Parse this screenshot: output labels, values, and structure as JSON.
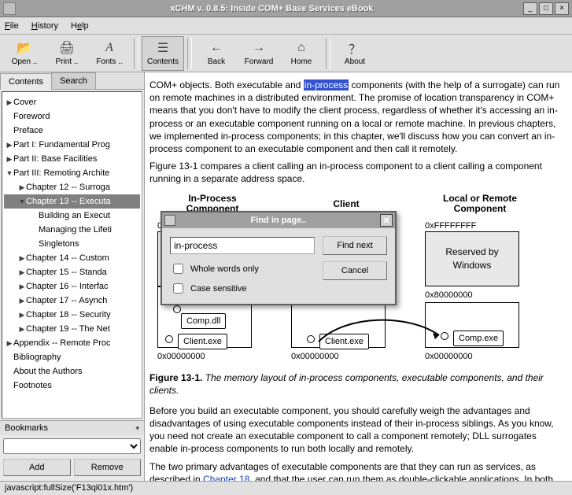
{
  "window": {
    "title": "xCHM v. 0.8.5: Inside COM+ Base Services eBook",
    "min_glyph": "_",
    "max_glyph": "□",
    "close_glyph": "×"
  },
  "menu": {
    "file": "File",
    "history": "History",
    "help": "Help"
  },
  "toolbar": {
    "open": "Open ..",
    "print": "Print ..",
    "fonts": "Fonts ..",
    "contents": "Contents",
    "back": "Back",
    "forward": "Forward",
    "home": "Home",
    "about": "About"
  },
  "sidebar": {
    "tabs": {
      "contents": "Contents",
      "search": "Search"
    },
    "tree": [
      {
        "label": "Cover",
        "lvl": 0,
        "exp": "▶"
      },
      {
        "label": "Foreword",
        "lvl": 0,
        "exp": ""
      },
      {
        "label": "Preface",
        "lvl": 0,
        "exp": ""
      },
      {
        "label": "Part I: Fundamental Prog",
        "lvl": 0,
        "exp": "▶"
      },
      {
        "label": "Part II: Base Facilities",
        "lvl": 0,
        "exp": "▶"
      },
      {
        "label": "Part III: Remoting Archite",
        "lvl": 0,
        "exp": "▼"
      },
      {
        "label": "Chapter 12 -- Surroga",
        "lvl": 1,
        "exp": "▶"
      },
      {
        "label": "Chapter 13 -- Executa",
        "lvl": 1,
        "exp": "▼",
        "sel": true
      },
      {
        "label": "Building an Execut",
        "lvl": 2,
        "exp": ""
      },
      {
        "label": "Managing the Lifeti",
        "lvl": 2,
        "exp": ""
      },
      {
        "label": "Singletons",
        "lvl": 2,
        "exp": ""
      },
      {
        "label": "Chapter 14 -- Custom",
        "lvl": 1,
        "exp": "▶"
      },
      {
        "label": "Chapter 15 -- Standa",
        "lvl": 1,
        "exp": "▶"
      },
      {
        "label": "Chapter 16 -- Interfac",
        "lvl": 1,
        "exp": "▶"
      },
      {
        "label": "Chapter 17 -- Asynch",
        "lvl": 1,
        "exp": "▶"
      },
      {
        "label": "Chapter 18 -- Security",
        "lvl": 1,
        "exp": "▶"
      },
      {
        "label": "Chapter 19 -- The Net",
        "lvl": 1,
        "exp": "▶"
      },
      {
        "label": "Appendix -- Remote Proc",
        "lvl": 0,
        "exp": "▶"
      },
      {
        "label": "Bibliography",
        "lvl": 0,
        "exp": ""
      },
      {
        "label": "About the Authors",
        "lvl": 0,
        "exp": ""
      },
      {
        "label": "Footnotes",
        "lvl": 0,
        "exp": ""
      }
    ],
    "bookmarks_label": "Bookmarks",
    "add": "Add",
    "remove": "Remove"
  },
  "content": {
    "p1a": "COM+ objects. Both executable and ",
    "p1_hl": "in-process",
    "p1b": " components (with the help of a surrogate) can run on remote machines in a distributed environment. The promise of location transparency in COM+ means that you don't have to modify the client process, regardless of whether it's accessing an in-process or an executable component running on a local or remote machine. In previous chapters, we implemented in-process components; in this chapter, we'll discuss how you can convert an in-process component to an executable component and then call it remotely.",
    "p2": "Figure 13-1 compares a client calling an in-process component to a client calling a component running in a separate address space.",
    "diagram": {
      "col1": "In-Process\nComponent",
      "col2": "Client",
      "col3": "Local or Remote\nComponent",
      "addr_top": "0xFFFFFFFF",
      "addr_mid": "0x80000000",
      "addr_bot": "0x00000000",
      "reserved": "Reserved by\nWindows",
      "comp_dll": "Comp.dll",
      "client_exe": "Client.exe",
      "comp_exe": "Comp.exe"
    },
    "figcap_b": "Figure 13-1.",
    "figcap_i": " The memory layout of in-process components, executable components, and their clients.",
    "p3": "Before you build an executable component, you should carefully weigh the advantages and disadvantages of using executable components instead of their in-process siblings. As you know, you need not create an executable component to call a component remotely; DLL surrogates enable in-process components to run both locally and remotely.",
    "p4a": "The two primary advantages of executable components are that they can run as services, as described in ",
    "p4_link": "Chapter 18",
    "p4b": ", and that the user can run them as double-clickable applications. In both cases, you can"
  },
  "find": {
    "title": "Find in page..",
    "value": "in-process",
    "find_next": "Find next",
    "cancel": "Cancel",
    "whole": "Whole words only",
    "case": "Case sensitive"
  },
  "status": "javascript:fullSize('F13qi01x.htm')"
}
